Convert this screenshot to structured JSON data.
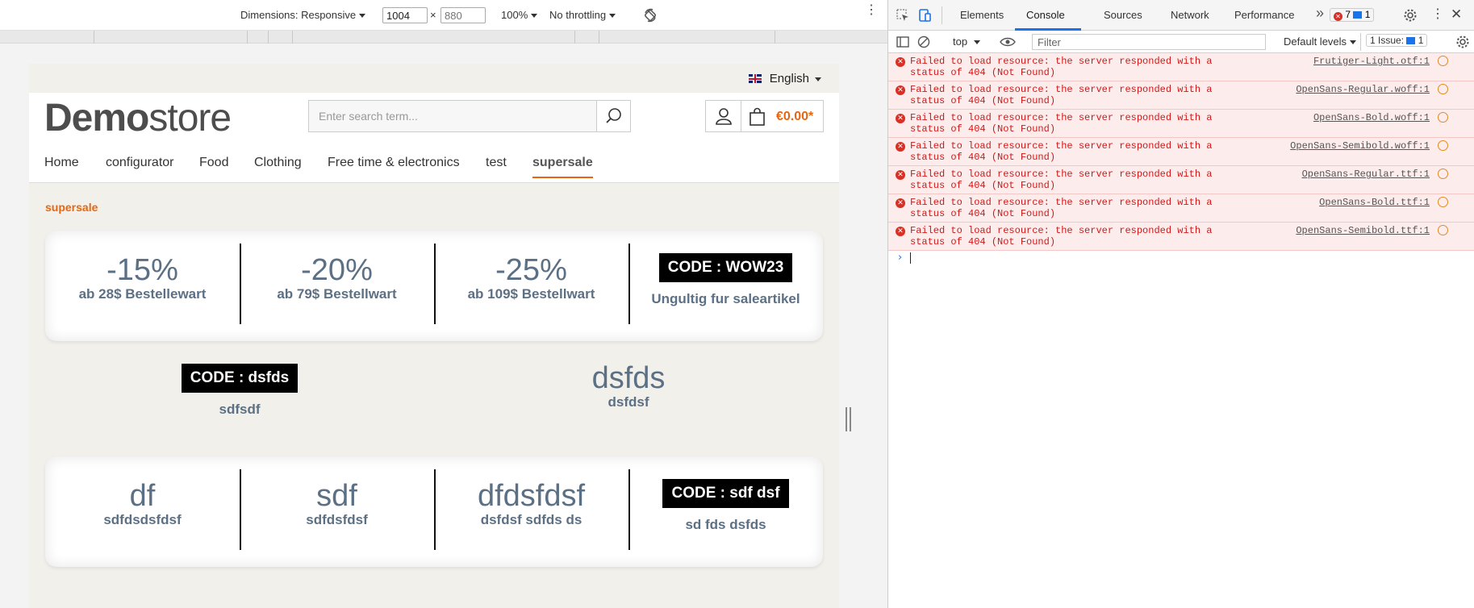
{
  "devbar": {
    "dimensions_label": "Dimensions: Responsive",
    "width_value": "1004",
    "times": "×",
    "height_placeholder": "880",
    "zoom": "100%",
    "throttling": "No throttling"
  },
  "site": {
    "language": "English",
    "logo_bold": "Demo",
    "logo_light": "store",
    "search_placeholder": "Enter search term...",
    "cart_total": "€0.00*",
    "nav": [
      "Home",
      "configurator",
      "Food",
      "Clothing",
      "Free time & electronics",
      "test",
      "supersale"
    ],
    "breadcrumb": "supersale",
    "promo_row1": [
      {
        "big": "-15%",
        "sub": "ab 28$ Bestellewart"
      },
      {
        "big": "-20%",
        "sub": "ab 79$ Bestellwart"
      },
      {
        "big": "-25%",
        "sub": "ab 109$ Bestellwart"
      },
      {
        "code": "CODE : WOW23",
        "sub": "Ungultig fur saleartikel"
      }
    ],
    "promo_row2": [
      {
        "code": "CODE : dsfds",
        "sub": "sdfsdf"
      },
      {
        "big": "dsfds",
        "sub": "dsfdsf"
      }
    ],
    "promo_row3": [
      {
        "big": "df",
        "sub": "sdfdsdsfdsf"
      },
      {
        "big": "sdf",
        "sub": "sdfdsfdsf"
      },
      {
        "big": "dfdsfdsf",
        "sub": "dsfdsf sdfds ds"
      },
      {
        "code": "CODE : sdf dsf",
        "sub": "sd fds dsfds"
      }
    ]
  },
  "devtools": {
    "tabs": [
      "Elements",
      "Console",
      "Sources",
      "Network",
      "Performance"
    ],
    "more_tabs": "»",
    "error_count": "7",
    "info_count": "1",
    "context": "top",
    "filter_placeholder": "Filter",
    "levels": "Default levels",
    "issues": "1 Issue:",
    "issues_count": "1",
    "messages": [
      {
        "text": "Failed to load resource: the server responded with a status of 404 (Not Found)",
        "source": "Frutiger-Light.otf:1"
      },
      {
        "text": "Failed to load resource: the server responded with a status of 404 (Not Found)",
        "source": "OpenSans-Regular.woff:1"
      },
      {
        "text": "Failed to load resource: the server responded with a status of 404 (Not Found)",
        "source": "OpenSans-Bold.woff:1"
      },
      {
        "text": "Failed to load resource: the server responded with a status of 404 (Not Found)",
        "source": "OpenSans-Semibold.woff:1"
      },
      {
        "text": "Failed to load resource: the server responded with a status of 404 (Not Found)",
        "source": "OpenSans-Regular.ttf:1"
      },
      {
        "text": "Failed to load resource: the server responded with a status of 404 (Not Found)",
        "source": "OpenSans-Bold.ttf:1"
      },
      {
        "text": "Failed to load resource: the server responded with a status of 404 (Not Found)",
        "source": "OpenSans-Semibold.ttf:1"
      }
    ]
  },
  "colors": {
    "accent": "#e86612",
    "promo_text": "#5c7085",
    "error": "#d21919"
  }
}
